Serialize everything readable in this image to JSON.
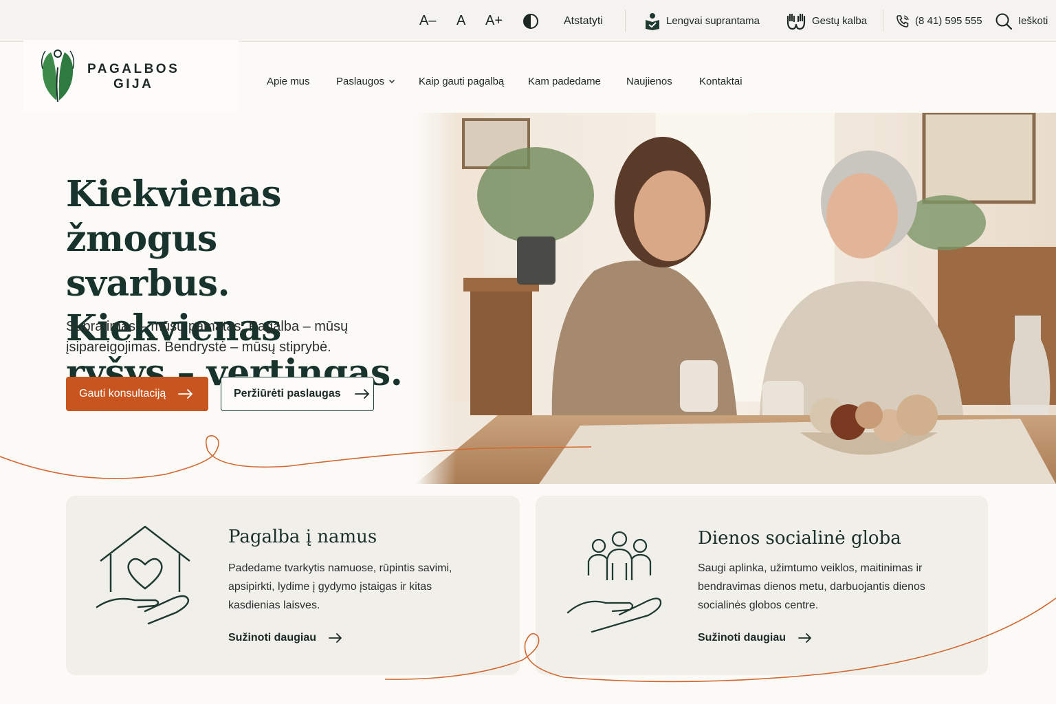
{
  "topbar": {
    "font_decrease": "A–",
    "font_normal": "A",
    "font_increase": "A+",
    "reset": "Atstatyti",
    "easy_read": "Lengvai suprantama",
    "sign_language": "Gestų kalba",
    "phone": "(8 41) 595 555",
    "search": "Ieškoti"
  },
  "logo": {
    "line1": "PAGALBOS",
    "line2": "GIJA"
  },
  "nav": {
    "items": [
      {
        "label": "Apie mus"
      },
      {
        "label": "Paslaugos"
      },
      {
        "label": "Kaip gauti pagalbą"
      },
      {
        "label": "Kam padedame"
      },
      {
        "label": "Naujienos"
      },
      {
        "label": "Kontaktai"
      }
    ]
  },
  "hero": {
    "title_l1": "Kiekvienas žmogus",
    "title_l2": "svarbus. Kiekvienas",
    "title_l3": "ryšys – vertingas.",
    "subtitle": "Supratimas – mūsų pamatas. Pagalba – mūsų įsipareigojimas. Bendrystė – mūsų stiprybė.",
    "primary_button": "Gauti konsultaciją",
    "secondary_button": "Peržiūrėti paslaugas"
  },
  "cards": [
    {
      "title": "Pagalba į namus",
      "description": "Padedame tvarkytis namuose, rūpintis savimi, apsipirkti, lydime į gydymo įstaigas ir kitas kasdienias laisves.",
      "link": "Sužinoti daugiau",
      "icon": "house-heart-hand-icon"
    },
    {
      "title": "Dienos socialinė globa",
      "description": "Saugi aplinka, užimtumo veiklos, maitinimas ir bendravimas dienos metu, darbuojantis dienos socialinės globos centre.",
      "link": "Sužinoti daugiau",
      "icon": "people-hand-icon"
    }
  ],
  "colors": {
    "accent": "#c8541f",
    "brand_green": "#17332b",
    "logo_green": "#3d8a4a",
    "card_bg": "#f1efea",
    "page_bg": "#fbfaf7"
  }
}
